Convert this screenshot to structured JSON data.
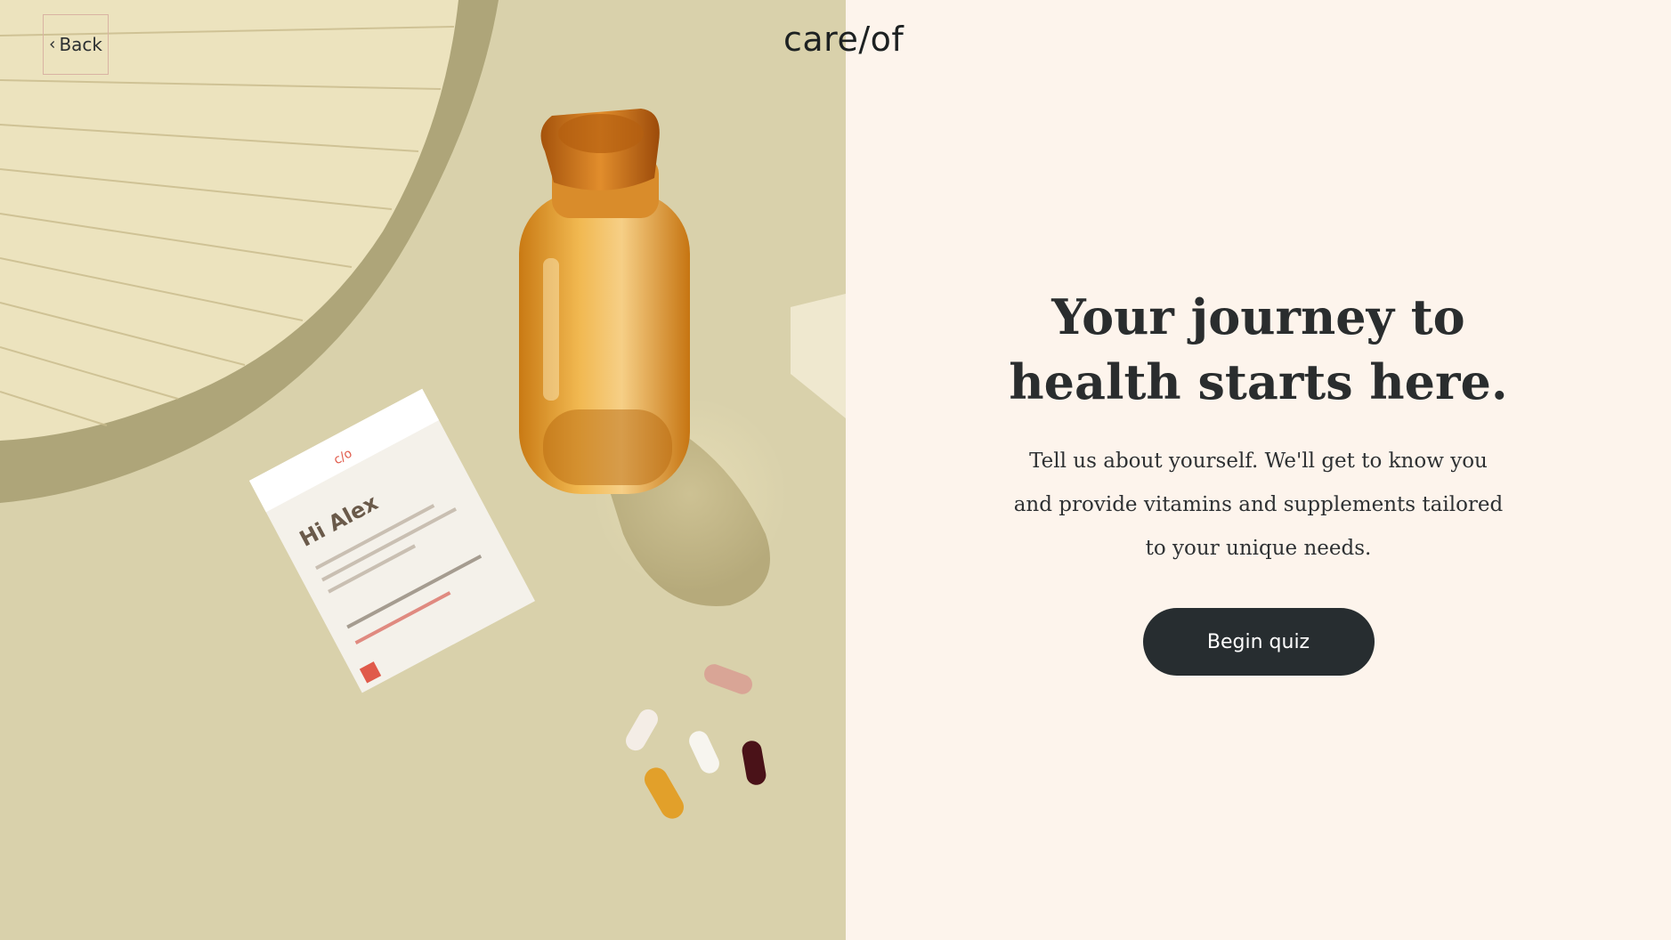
{
  "nav": {
    "back_label": "Back"
  },
  "brand": {
    "logo_text": "care/of"
  },
  "hero": {
    "title": "Your journey to health starts here.",
    "subtitle": "Tell us about yourself. We'll get to know you and provide vitamins and supplements tailored to your unique needs.",
    "cta_label": "Begin quiz"
  },
  "photo": {
    "packet_brand": "c/o",
    "packet_greeting": "Hi Alex"
  },
  "colors": {
    "background": "#fdf4ec",
    "photo_backdrop": "#d8cfa8",
    "button": "#272d30",
    "text": "#2a2d2e"
  }
}
